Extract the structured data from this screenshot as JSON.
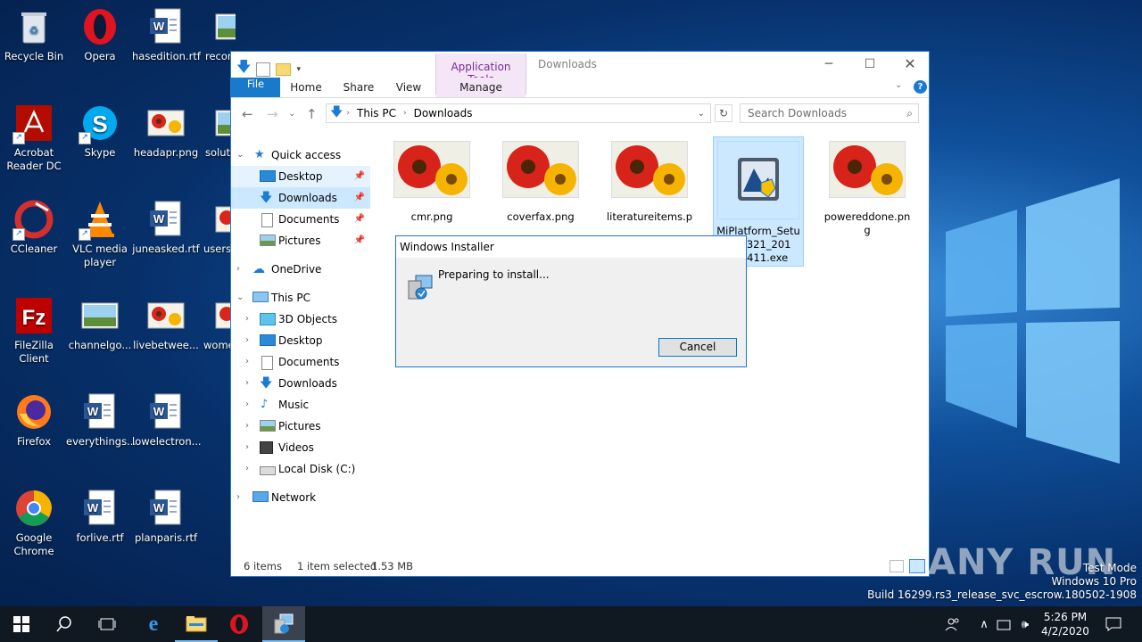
{
  "desktop": {
    "icons": [
      {
        "label": "Recycle Bin",
        "icon": "recycle-bin-icon"
      },
      {
        "label": "Opera",
        "icon": "opera-icon"
      },
      {
        "label": "hasedition.rtf",
        "icon": "word-doc-icon"
      },
      {
        "label": "recon",
        "icon": "image-file-icon"
      },
      {
        "label": "Acrobat Reader DC",
        "icon": "acrobat-icon"
      },
      {
        "label": "Skype",
        "icon": "skype-icon"
      },
      {
        "label": "headapr.png",
        "icon": "image-file-icon"
      },
      {
        "label": "soluti",
        "icon": "image-file-icon"
      },
      {
        "label": "CCleaner",
        "icon": "ccleaner-icon"
      },
      {
        "label": "VLC media player",
        "icon": "vlc-icon"
      },
      {
        "label": "juneasked.rtf",
        "icon": "word-doc-icon"
      },
      {
        "label": "usersr",
        "icon": "image-file-icon"
      },
      {
        "label": "FileZilla Client",
        "icon": "filezilla-icon"
      },
      {
        "label": "channelgo...",
        "icon": "image-file-icon"
      },
      {
        "label": "livebetwee...",
        "icon": "image-file-icon"
      },
      {
        "label": "wome",
        "icon": "image-file-icon"
      },
      {
        "label": "Firefox",
        "icon": "firefox-icon"
      },
      {
        "label": "everythings...",
        "icon": "word-doc-icon"
      },
      {
        "label": "lowelectron...",
        "icon": "word-doc-icon"
      },
      {
        "label": "Google Chrome",
        "icon": "chrome-icon"
      },
      {
        "label": "forlive.rtf",
        "icon": "word-doc-icon"
      },
      {
        "label": "planparis.rtf",
        "icon": "word-doc-icon"
      }
    ]
  },
  "explorer": {
    "app_tools": "Application Tools",
    "title": "Downloads",
    "tabs": {
      "file": "File",
      "home": "Home",
      "share": "Share",
      "view": "View",
      "manage": "Manage"
    },
    "address": {
      "root": "This PC",
      "current": "Downloads"
    },
    "search_placeholder": "Search Downloads",
    "nav": {
      "quick_access": "Quick access",
      "qa_desktop": "Desktop",
      "qa_downloads": "Downloads",
      "qa_documents": "Documents",
      "qa_pictures": "Pictures",
      "onedrive": "OneDrive",
      "this_pc": "This PC",
      "objects3d": "3D Objects",
      "pc_desktop": "Desktop",
      "pc_documents": "Documents",
      "pc_downloads": "Downloads",
      "music": "Music",
      "pc_pictures": "Pictures",
      "videos": "Videos",
      "local_disk": "Local Disk (C:)",
      "network": "Network"
    },
    "files": [
      {
        "name": "cmr.png",
        "type": "image"
      },
      {
        "name": "coverfax.png",
        "type": "image"
      },
      {
        "name": "literatureitems.p",
        "type": "image"
      },
      {
        "name": "MiPlatform_Setup_Updater321_2017_1411.exe",
        "name_line1": "MiPlatform_Setu",
        "name_line2": "ater321_201",
        "name_line3": "7_1411.exe",
        "type": "installer"
      },
      {
        "name": "powereddone.png",
        "name_line1": "powereddone.pn",
        "name_line2": "g",
        "type": "image"
      }
    ],
    "status": {
      "count": "6 items",
      "selection": "1 item selected",
      "size": "1.53 MB"
    }
  },
  "installer": {
    "title": "Windows Installer",
    "message": "Preparing to install...",
    "cancel": "Cancel"
  },
  "taskbar": {
    "time": "5:26 PM",
    "date": "4/2/2020"
  },
  "watermark": {
    "line1": "Test Mode",
    "line2": "Windows 10 Pro",
    "line3": "Build 16299.rs3_release_svc_escrow.180502-1908",
    "brand": "ANY RUN"
  }
}
